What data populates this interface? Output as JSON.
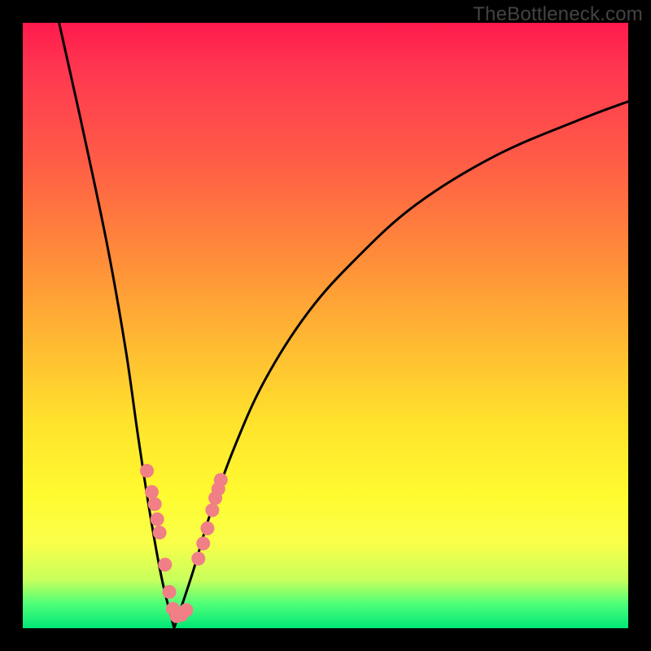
{
  "watermark": "TheBottleneck.com",
  "colors": {
    "frame": "#000000",
    "curve": "#000000",
    "marker": "#f07f86",
    "gradient_top": "#ff1a4d",
    "gradient_bottom": "#00e676"
  },
  "chart_data": {
    "type": "line",
    "title": "",
    "xlabel": "",
    "ylabel": "",
    "xlim": [
      0,
      100
    ],
    "ylim": [
      0,
      100
    ],
    "grid": false,
    "legend": false,
    "note": "Axis values are approximate positions read from the un-labeled plot area (0–100 each axis, origin bottom-left). The two black curves meet near x≈25 at the bottom; pink markers are a scatter series clustered along both curves near that minimum.",
    "series": [
      {
        "name": "left-curve",
        "type": "line",
        "x": [
          6,
          10,
          14,
          17,
          19,
          21,
          23,
          25
        ],
        "y": [
          100,
          82,
          63,
          46,
          32,
          19,
          8,
          0
        ]
      },
      {
        "name": "right-curve",
        "type": "line",
        "x": [
          25,
          28,
          31,
          35,
          40,
          47,
          55,
          65,
          78,
          92,
          100
        ],
        "y": [
          0,
          9,
          19,
          30,
          41,
          52,
          61,
          70,
          78,
          84,
          87
        ]
      },
      {
        "name": "markers",
        "type": "scatter",
        "x": [
          20.5,
          21.3,
          21.8,
          22.2,
          22.6,
          23.5,
          24.2,
          24.8,
          25.4,
          26.2,
          27.0,
          29.0,
          29.8,
          30.5,
          31.3,
          31.8,
          32.3,
          32.7
        ],
        "y": [
          26.0,
          22.5,
          20.5,
          18.0,
          15.8,
          10.5,
          6.0,
          3.2,
          2.0,
          2.2,
          3.0,
          11.5,
          14.0,
          16.5,
          19.5,
          21.5,
          23.0,
          24.5
        ]
      }
    ]
  }
}
